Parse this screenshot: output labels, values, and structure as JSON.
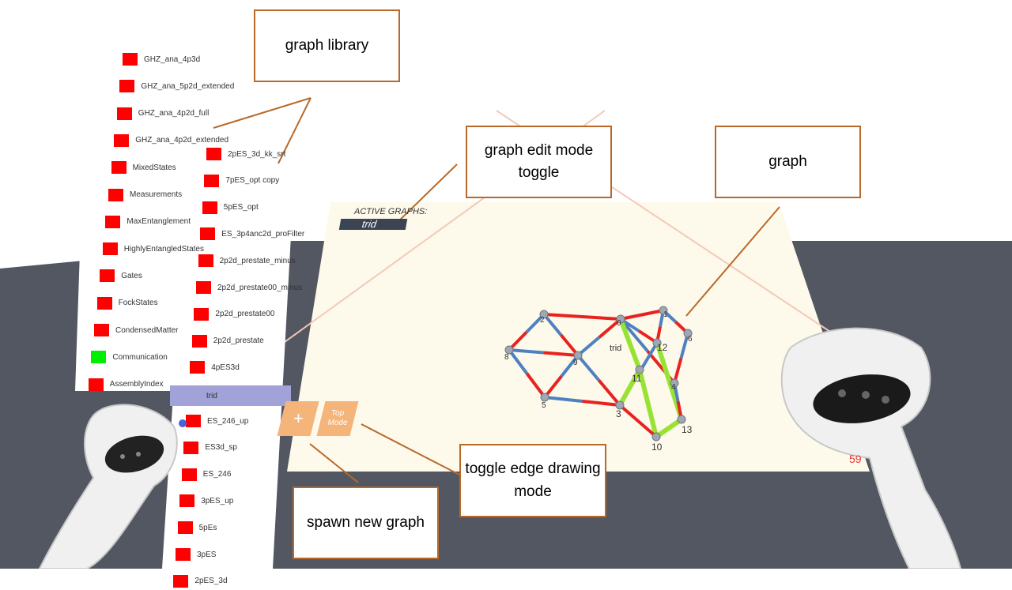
{
  "library": {
    "column1": [
      {
        "label": "GHZ_ana_4p3d",
        "color": "red"
      },
      {
        "label": "GHZ_ana_5p2d_extended",
        "color": "red"
      },
      {
        "label": "GHZ_ana_4p2d_full",
        "color": "red"
      },
      {
        "label": "GHZ_ana_4p2d_extended",
        "color": "red"
      },
      {
        "label": "MixedStates",
        "color": "red"
      },
      {
        "label": "Measurements",
        "color": "red"
      },
      {
        "label": "MaxEntanglement",
        "color": "red"
      },
      {
        "label": "HighlyEntangledStates",
        "color": "red"
      },
      {
        "label": "Gates",
        "color": "red"
      },
      {
        "label": "FockStates",
        "color": "red"
      },
      {
        "label": "CondensedMatter",
        "color": "red"
      },
      {
        "label": "Communication",
        "color": "green"
      },
      {
        "label": "AssemblyIndex",
        "color": "red"
      }
    ],
    "column2": [
      {
        "label": "2pES_3d_kk_srt",
        "color": "red"
      },
      {
        "label": "7pES_opt copy",
        "color": "red"
      },
      {
        "label": "5pES_opt",
        "color": "red"
      },
      {
        "label": "ES_3p4anc2d_proFilter",
        "color": "red"
      },
      {
        "label": "2p2d_prestate_minus",
        "color": "red"
      },
      {
        "label": "2p2d_prestate00_minus",
        "color": "red"
      },
      {
        "label": "2p2d_prestate00",
        "color": "red"
      },
      {
        "label": "2p2d_prestate",
        "color": "red"
      },
      {
        "label": "4pES3d",
        "color": "red"
      },
      {
        "label": "trid",
        "color": "none",
        "selected": true
      },
      {
        "label": "ES_246_up",
        "color": "red"
      },
      {
        "label": "ES3d_sp",
        "color": "red"
      },
      {
        "label": "ES_246",
        "color": "red"
      },
      {
        "label": "3pES_up",
        "color": "red"
      },
      {
        "label": "5pEs",
        "color": "red"
      },
      {
        "label": "3pES",
        "color": "red"
      },
      {
        "label": "2pES_3d",
        "color": "red"
      }
    ]
  },
  "active_graphs": {
    "label": "ACTIVE GRAPHS:",
    "tab": "trid"
  },
  "buttons": {
    "spawn": "+",
    "top_mode": "Top Mode"
  },
  "graph": {
    "name": "trid",
    "frame_counter": "59",
    "nodes": [
      {
        "id": "0"
      },
      {
        "id": "1"
      },
      {
        "id": "2"
      },
      {
        "id": "3"
      },
      {
        "id": "4"
      },
      {
        "id": "5"
      },
      {
        "id": "6"
      },
      {
        "id": "8"
      },
      {
        "id": "9"
      },
      {
        "id": "10"
      },
      {
        "id": "11"
      },
      {
        "id": "12"
      },
      {
        "id": "13"
      }
    ],
    "edges": [
      {
        "from": "2",
        "to": "0",
        "kind": "red"
      },
      {
        "from": "2",
        "to": "8",
        "kind": "blue-red"
      },
      {
        "from": "2",
        "to": "9",
        "kind": "blue-red"
      },
      {
        "from": "8",
        "to": "5",
        "kind": "blue-red"
      },
      {
        "from": "8",
        "to": "9",
        "kind": "blue-red"
      },
      {
        "from": "9",
        "to": "0",
        "kind": "blue-red"
      },
      {
        "from": "9",
        "to": "5",
        "kind": "blue-red"
      },
      {
        "from": "9",
        "to": "3",
        "kind": "blue-red"
      },
      {
        "from": "5",
        "to": "3",
        "kind": "blue-red"
      },
      {
        "from": "0",
        "to": "1",
        "kind": "red"
      },
      {
        "from": "0",
        "to": "12",
        "kind": "blue-red"
      },
      {
        "from": "0",
        "to": "4",
        "kind": "blue-red"
      },
      {
        "from": "0",
        "to": "11",
        "kind": "green"
      },
      {
        "from": "1",
        "to": "6",
        "kind": "blue-red"
      },
      {
        "from": "1",
        "to": "12",
        "kind": "blue-red"
      },
      {
        "from": "6",
        "to": "4",
        "kind": "blue-red"
      },
      {
        "from": "12",
        "to": "3",
        "kind": "blue-red"
      },
      {
        "from": "12",
        "to": "13",
        "kind": "green"
      },
      {
        "from": "11",
        "to": "3",
        "kind": "green"
      },
      {
        "from": "11",
        "to": "10",
        "kind": "green"
      },
      {
        "from": "3",
        "to": "10",
        "kind": "red"
      },
      {
        "from": "10",
        "to": "13",
        "kind": "green"
      },
      {
        "from": "4",
        "to": "13",
        "kind": "blue-red"
      }
    ]
  },
  "callouts": {
    "graph_library": "graph library",
    "edit_mode": "graph edit mode toggle",
    "graph": "graph",
    "edge_mode": "toggle edge drawing mode",
    "spawn": "spawn new graph"
  },
  "colors": {
    "table": "#535761",
    "board": "#fdf9eb",
    "edge_red": "#e8231f",
    "edge_blue": "#4f81c0",
    "edge_green": "#99e233",
    "node": "#9ea7b3",
    "button": "#f5b47a",
    "selected": "#a0a2d8",
    "callout_border": "#b8692a"
  }
}
